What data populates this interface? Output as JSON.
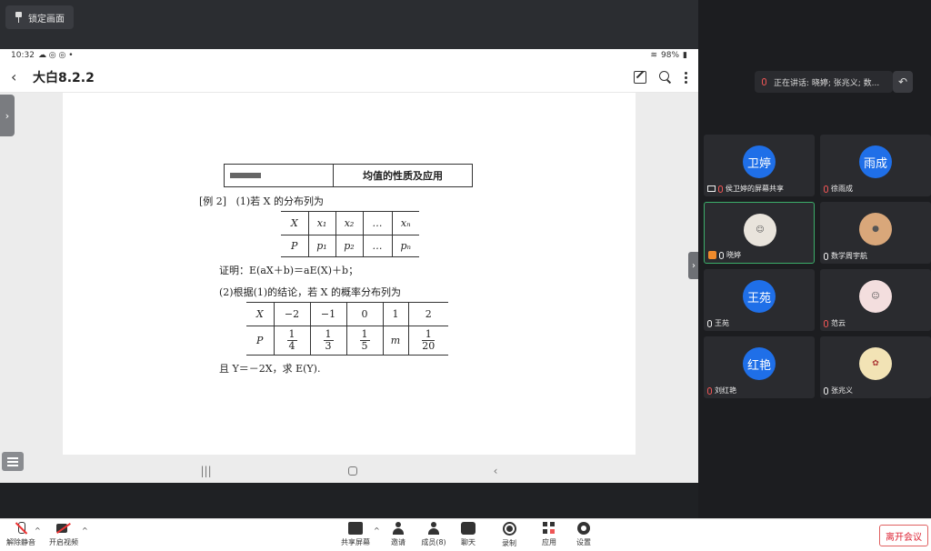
{
  "top": {
    "lock_label": "锁定画面"
  },
  "tablet": {
    "status_time": "10:32",
    "status_battery": "98%",
    "app_title": "大白8.2.2",
    "doc": {
      "section_title": "均值的性质及应用",
      "example_label": "[例 2]",
      "q1_text": "(1)若 X 的分布列为",
      "table1_row1": [
        "X",
        "x₁",
        "x₂",
        "…",
        "xₙ"
      ],
      "table1_row2": [
        "P",
        "p₁",
        "p₂",
        "…",
        "pₙ"
      ],
      "proof_text": "证明：E(aX＋b)＝aE(X)＋b；",
      "q2_text": "(2)根据(1)的结论，若 X 的概率分布列为",
      "table2_row1": [
        "X",
        "−2",
        "−1",
        "0",
        "1",
        "2"
      ],
      "table2_row2_label": "P",
      "table2_row2_m": "m",
      "fracs": [
        {
          "n": "1",
          "d": "4"
        },
        {
          "n": "1",
          "d": "3"
        },
        {
          "n": "1",
          "d": "5"
        },
        {
          "n": "1",
          "d": "20"
        }
      ],
      "final_text": "且 Y＝－2X，求 E(Y)."
    }
  },
  "panel": {
    "speaking": "正在讲话: 晓婷; 张兆义; 数...",
    "participants": [
      {
        "avatar": "卫婷",
        "name": "侯卫婷的屏幕共享"
      },
      {
        "avatar": "雨成",
        "name": "徐雨成"
      },
      {
        "avatar": "",
        "name": "晓婷"
      },
      {
        "avatar": "",
        "name": "数学周宇航"
      },
      {
        "avatar": "王苑",
        "name": "王苑"
      },
      {
        "avatar": "",
        "name": "范云"
      },
      {
        "avatar": "红艳",
        "name": "刘红艳"
      },
      {
        "avatar": "",
        "name": "张兆义"
      }
    ]
  },
  "toolbar": {
    "unmute": "解除静音",
    "start_video": "开启视频",
    "share": "共享屏幕",
    "invite": "邀请",
    "members": "成员(8)",
    "chat": "聊天",
    "record": "录制",
    "apps": "应用",
    "settings": "设置",
    "leave": "离开会议"
  }
}
